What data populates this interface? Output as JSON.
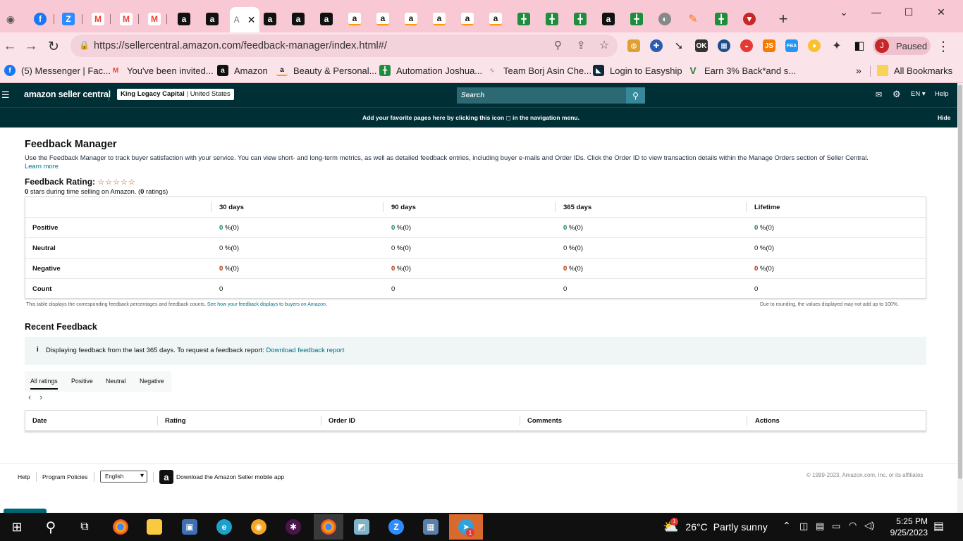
{
  "browser": {
    "url": "https://sellercentral.amazon.com/feedback-manager/index.html#/",
    "active_tab_letter": "A",
    "new_tab_icon": "+",
    "profile_initial": "J",
    "profile_status": "Paused",
    "bookmarks": [
      {
        "label": "(5) Messenger | Fac...",
        "icon": "facebook-icon",
        "color": "#1877f2"
      },
      {
        "label": "You've been invited...",
        "icon": "gmail-icon",
        "color": "#ea4335"
      },
      {
        "label": "Amazon",
        "icon": "amazon-icon",
        "color": "#111111"
      },
      {
        "label": "Beauty & Personal...",
        "icon": "amazon-smile-icon",
        "color": "#ffffff"
      },
      {
        "label": "Automation Joshua...",
        "icon": "sheets-icon",
        "color": "#1e8e3e"
      },
      {
        "label": "Team Borj Asin Che...",
        "icon": "team-icon",
        "color": "#b0a0a8"
      },
      {
        "label": "Login to Easyship",
        "icon": "easyship-icon",
        "color": "#0b2b3b"
      },
      {
        "label": "Earn 3% Back*and s...",
        "icon": "earn-icon",
        "color": "#2e7d32"
      }
    ],
    "all_bookmarks": "All Bookmarks",
    "bookmarks_overflow": "»"
  },
  "header": {
    "logo": "amazon seller central",
    "store": "King Legacy Capital",
    "marketplace": "United States",
    "search_placeholder": "Search",
    "language": "EN",
    "help": "Help",
    "banner_pre": "Add your favorite pages here by clicking this icon",
    "banner_post": "in the navigation menu.",
    "hide": "Hide"
  },
  "page": {
    "title": "Feedback Manager",
    "description": "Use the Feedback Manager to track buyer satisfaction with your service. You can view short- and long-term metrics, as well as detailed feedback entries, including buyer e-mails and Order IDs. Click the Order ID to view transaction details within the Manage Orders section of Seller Central.",
    "learn_more": "Learn more",
    "rating_label": "Feedback Rating:",
    "stars_prefix": "0",
    "stars_text": " stars during time selling on Amazon. (",
    "ratings_count": "0",
    "ratings_suffix": " ratings)",
    "table": {
      "headers": [
        "30 days",
        "90 days",
        "365 days",
        "Lifetime"
      ],
      "rows": [
        {
          "label": "Positive",
          "values": [
            "0",
            "0",
            "0",
            "0"
          ],
          "suffix": " %(0)"
        },
        {
          "label": "Neutral",
          "values": [
            "0",
            "0",
            "0",
            "0"
          ],
          "suffix": " %(0)"
        },
        {
          "label": "Negative",
          "values": [
            "0",
            "0",
            "0",
            "0"
          ],
          "suffix": " %(0)"
        },
        {
          "label": "Count",
          "values": [
            "0",
            "0",
            "0",
            "0"
          ],
          "suffix": ""
        }
      ]
    },
    "table_note_left": "This table displays the corresponding feedback percentages and feedback counts.",
    "table_note_link": "See how your feedback displays to buyers on Amazon.",
    "table_note_right": "Due to rounding, the values displayed may not add up to 100%.",
    "recent_title": "Recent Feedback",
    "info_text": "Displaying feedback from the last 365 days. To request a feedback report:",
    "info_link": "Download feedback report",
    "filter_tabs": [
      "All ratings",
      "Positive",
      "Neutral",
      "Negative"
    ],
    "pager_prev": "‹",
    "pager_next": "›",
    "feedback_headers": [
      "Date",
      "Rating",
      "Order ID",
      "Comments",
      "Actions"
    ]
  },
  "footer": {
    "help": "Help",
    "policies": "Program Policies",
    "language": "English",
    "app": "Download the Amazon Seller mobile app",
    "copyright": "© 1999-2023, Amazon.com, Inc. or its affiliates"
  },
  "taskbar": {
    "weather_temp": "26°C",
    "weather_text": "Partly sunny",
    "weather_badge": "1",
    "time": "5:25 PM",
    "date": "9/25/2023",
    "telegram_badge": "1"
  },
  "colors": {
    "chrome_pink": "#f8c8d4",
    "seller_header": "#002f36",
    "positive_green": "#067d62",
    "negative_red": "#b12704",
    "link_teal": "#007185"
  }
}
